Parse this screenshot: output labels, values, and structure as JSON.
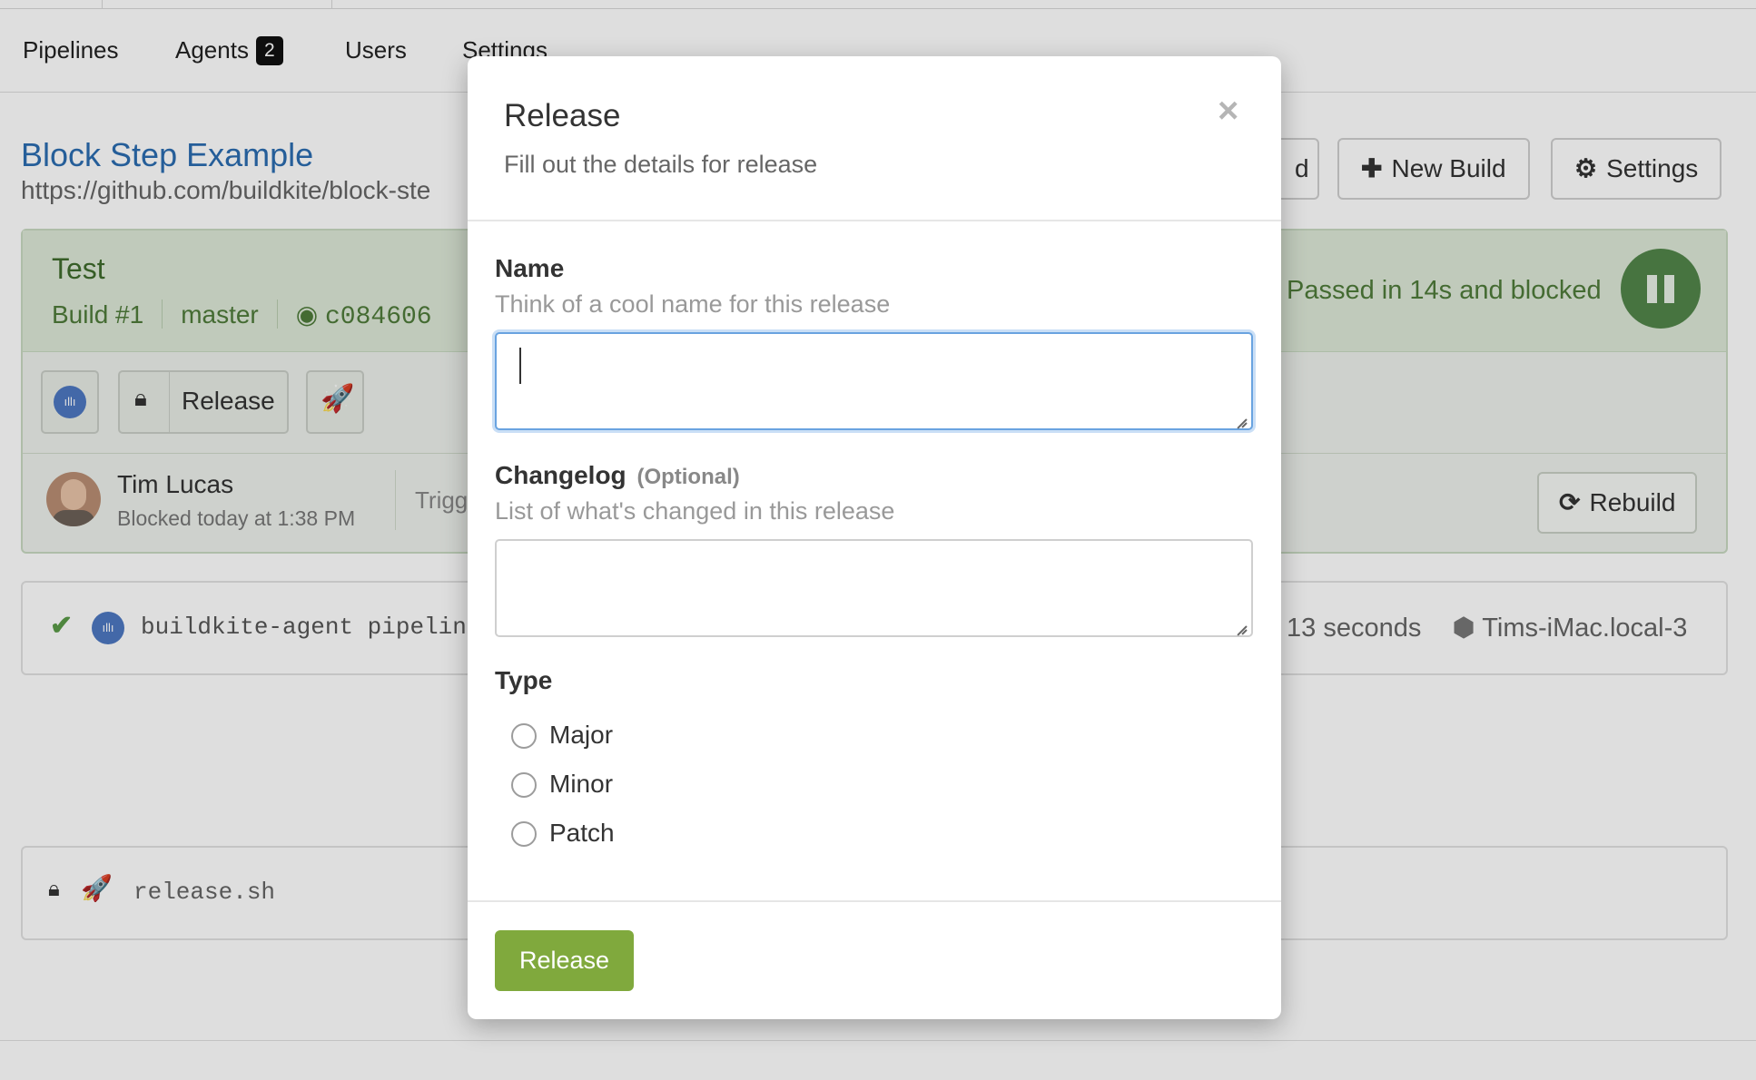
{
  "nav": {
    "items": [
      "Pipelines",
      "Agents",
      "Users",
      "Settings"
    ],
    "agents_count": "2"
  },
  "pipeline": {
    "title": "Block Step Example",
    "url": "https://github.com/buildkite/block-ste",
    "buttons": {
      "hidden_partial": "d",
      "new_build": "New Build",
      "settings": "Settings"
    }
  },
  "build": {
    "name": "Test",
    "number": "Build #1",
    "branch": "master",
    "commit": "c084606",
    "status": "Passed in 14s and blocked",
    "block_step_label": "Release",
    "author": "Tim Lucas",
    "blocked_time": "Blocked today at 1:38 PM",
    "triggered_partial": "Trigg",
    "rebuild_label": "Rebuild"
  },
  "job": {
    "command": "buildkite-agent pipeline",
    "duration": "13 seconds",
    "agent": "Tims-iMac.local-3"
  },
  "release_job": {
    "command": "release.sh"
  },
  "modal": {
    "title": "Release",
    "subtitle": "Fill out the details for release",
    "close": "×",
    "name_label": "Name",
    "name_hint": "Think of a cool name for this release",
    "name_value": "",
    "changelog_label": "Changelog",
    "changelog_optional": "(Optional)",
    "changelog_hint": "List of what's changed in this release",
    "changelog_value": "",
    "type_label": "Type",
    "type_options": [
      "Major",
      "Minor",
      "Patch"
    ],
    "submit_label": "Release"
  },
  "colors": {
    "link_blue": "#2b6cb0",
    "passed_green": "#4f7b3a",
    "submit_green": "#80a93d",
    "focus_blue": "#69a3e0"
  }
}
